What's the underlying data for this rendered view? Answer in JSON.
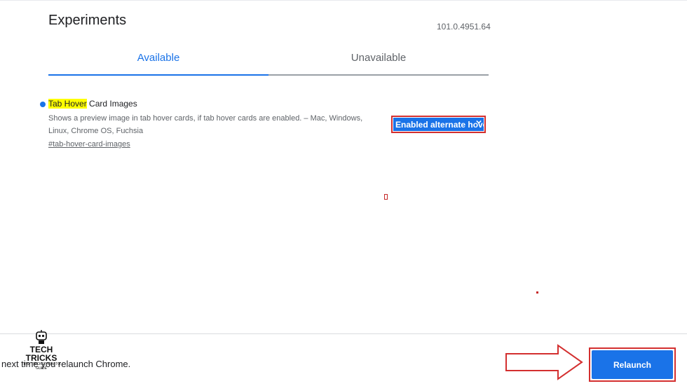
{
  "header": {
    "title": "Experiments",
    "version": "101.0.4951.64"
  },
  "tabs": [
    {
      "label": "Available",
      "selected": true
    },
    {
      "label": "Unavailable",
      "selected": false
    }
  ],
  "experiment": {
    "name_highlight": "Tab Hover",
    "name_rest": " Card Images",
    "description": "Shows a preview image in tab hover cards, if tab hover cards are enabled. – Mac, Windows, Linux, Chrome OS, Fuchsia",
    "link": "#tab-hover-card-images",
    "select_value": "Enabled alternate hover"
  },
  "footer": {
    "message": "next time you relaunch Chrome.",
    "relaunch_label": "Relaunch"
  },
  "watermark": {
    "title": "TECH TRICKS",
    "subtitle": "TIPS, TRICKS, HOW-TO, GUIDE"
  },
  "colors": {
    "accent": "#1a73e8",
    "highlight": "#ffff00",
    "annotation": "#d32f2f"
  }
}
